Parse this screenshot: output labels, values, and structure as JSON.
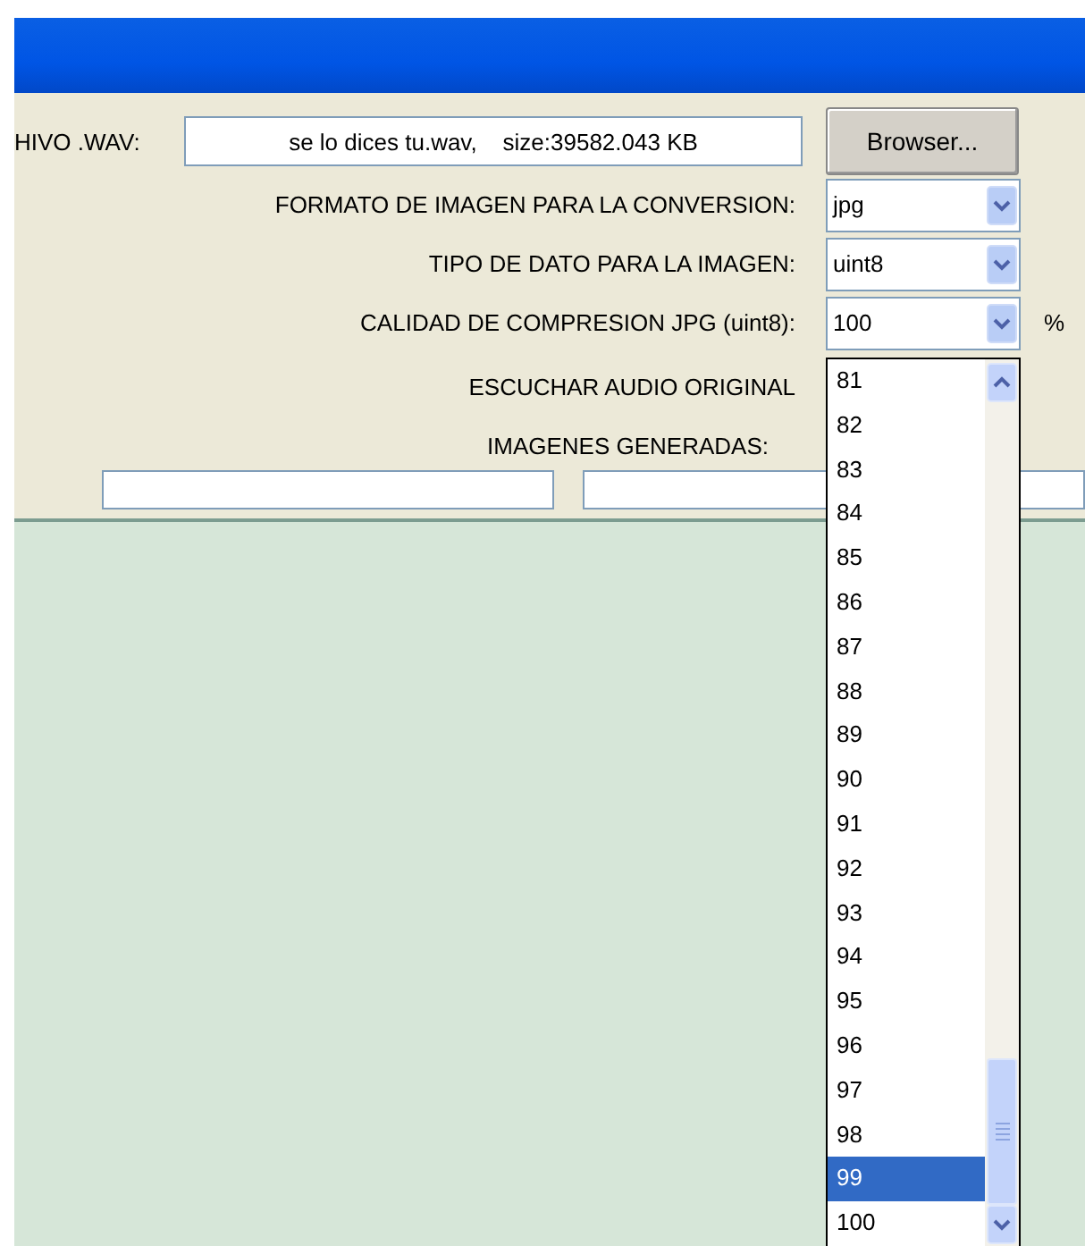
{
  "file_row": {
    "label": "HIVO .WAV:",
    "value": "se lo dices tu.wav,    size:39582.043 KB",
    "button": "Browser..."
  },
  "settings": [
    {
      "label": "FORMATO DE IMAGEN PARA LA CONVERSION:",
      "value": "jpg"
    },
    {
      "label": "TIPO DE DATO PARA LA IMAGEN:",
      "value": "uint8"
    },
    {
      "label": "CALIDAD DE COMPRESION JPG (uint8):",
      "value": "100",
      "suffix": "%"
    }
  ],
  "audio_label": "ESCUCHAR AUDIO ORIGINAL",
  "images_label": "IMAGENES GENERADAS:",
  "dropdown": {
    "options": [
      {
        "label": "81",
        "selected": false
      },
      {
        "label": "82",
        "selected": false
      },
      {
        "label": "83",
        "selected": false
      },
      {
        "label": "84",
        "selected": false
      },
      {
        "label": "85",
        "selected": false
      },
      {
        "label": "86",
        "selected": false
      },
      {
        "label": "87",
        "selected": false
      },
      {
        "label": "88",
        "selected": false
      },
      {
        "label": "89",
        "selected": false
      },
      {
        "label": "90",
        "selected": false
      },
      {
        "label": "91",
        "selected": false
      },
      {
        "label": "92",
        "selected": false
      },
      {
        "label": "93",
        "selected": false
      },
      {
        "label": "94",
        "selected": false
      },
      {
        "label": "95",
        "selected": false
      },
      {
        "label": "96",
        "selected": false
      },
      {
        "label": "97",
        "selected": false
      },
      {
        "label": "98",
        "selected": false
      },
      {
        "label": "99",
        "selected": true
      },
      {
        "label": "100",
        "selected": false
      }
    ]
  }
}
